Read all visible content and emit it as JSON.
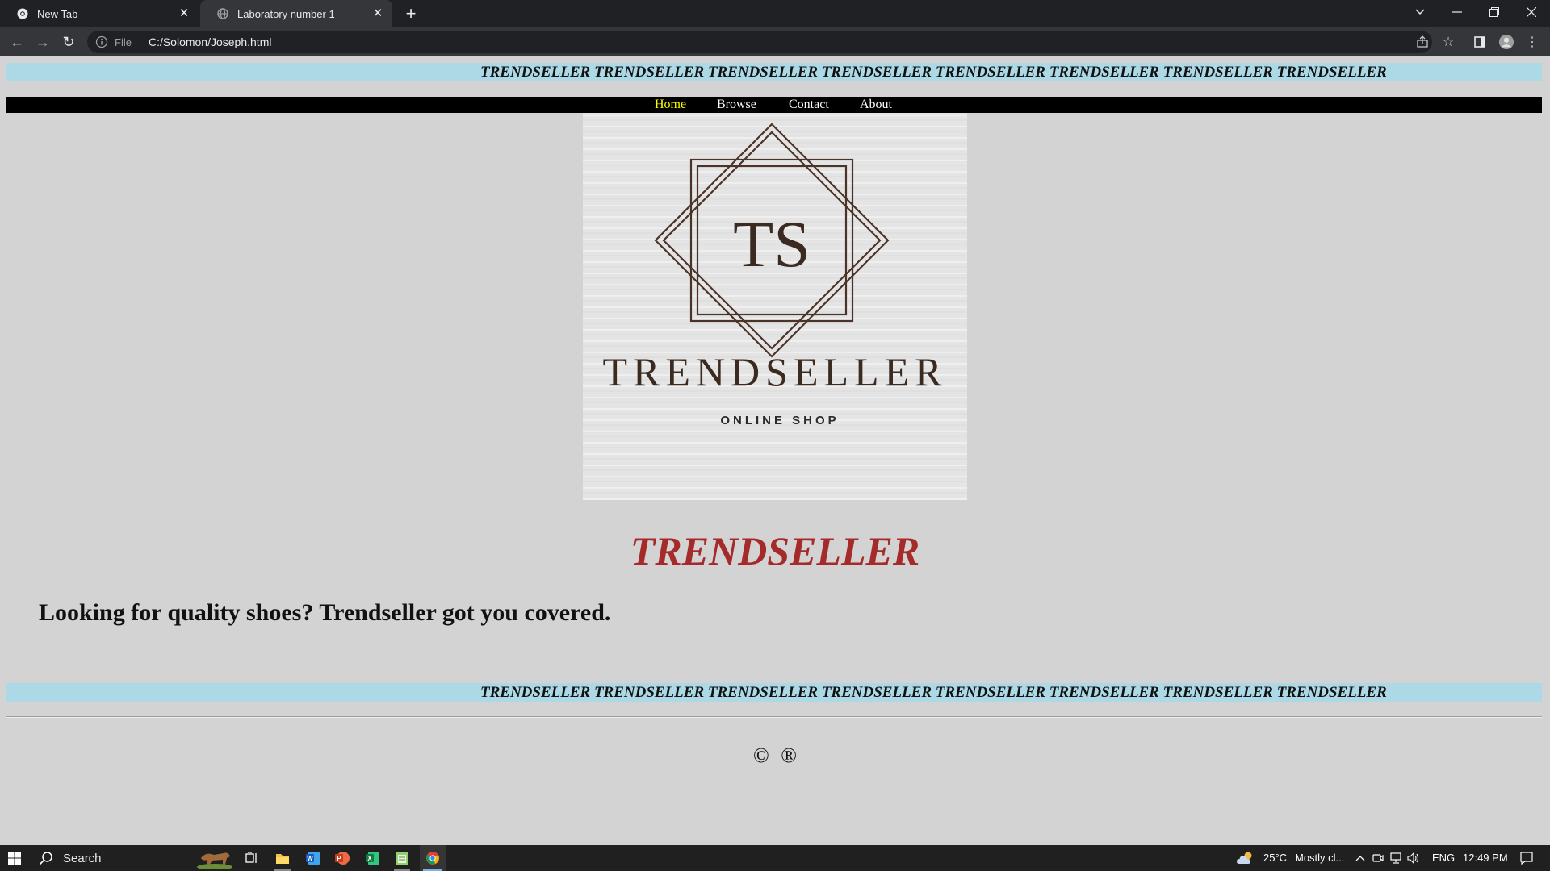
{
  "browser": {
    "tabs": [
      {
        "title": "New Tab",
        "active": false
      },
      {
        "title": "Laboratory number 1",
        "active": true
      }
    ],
    "address": {
      "scheme_label": "File",
      "url": "C:/Solomon/Joseph.html"
    }
  },
  "page": {
    "marquee_text": "TRENDSELLER TRENDSELLER TRENDSELLER TRENDSELLER TRENDSELLER TRENDSELLER TRENDSELLER TRENDSELLER",
    "nav": [
      {
        "label": "Home",
        "active": true
      },
      {
        "label": "Browse",
        "active": false
      },
      {
        "label": "Contact",
        "active": false
      },
      {
        "label": "About",
        "active": false
      }
    ],
    "logo": {
      "monogram": "TS",
      "brand": "TRENDSELLER",
      "subtitle": "ONLINE SHOP"
    },
    "title": "TRENDSELLER",
    "tagline": "Looking for quality shoes? Trendseller got you covered.",
    "footer_symbols": [
      "©",
      "®"
    ]
  },
  "taskbar": {
    "search_label": "Search",
    "weather": {
      "temp": "25°C",
      "condition": "Mostly cl..."
    },
    "language": "ENG",
    "time": "12:49 PM"
  },
  "colors": {
    "page_bg": "#d3d3d3",
    "marquee_bg": "#add8e6",
    "nav_bg": "#000000",
    "nav_active": "#ffff00",
    "title_color": "#a52a2a",
    "logo_ink": "#4a3328"
  }
}
